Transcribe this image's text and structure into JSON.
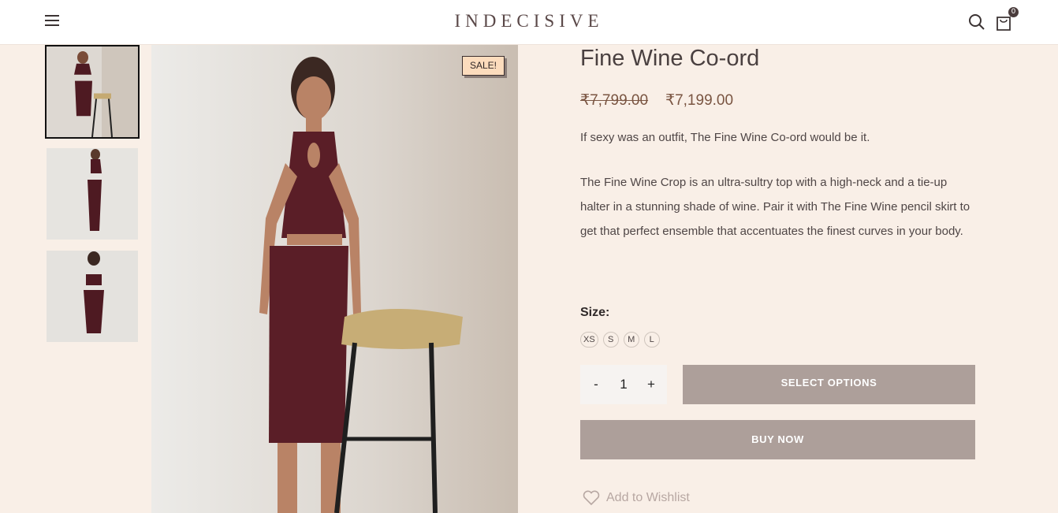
{
  "header": {
    "logo": "INDECISIVE",
    "cart_count": "0"
  },
  "gallery": {
    "sale_badge": "SALE!"
  },
  "product": {
    "title": "Fine Wine Co-ord",
    "price_old": "₹7,799.00",
    "price_new": "₹7,199.00",
    "tagline": "If sexy was an outfit, The Fine Wine Co-ord would be it.",
    "description": "The Fine Wine Crop is an ultra-sultry top with a high-neck and a tie-up halter in a stunning shade of wine. Pair it with The Fine Wine pencil skirt to get that perfect ensemble that accentuates the finest curves in your body.",
    "size_label": "Size:",
    "sizes": [
      "XS",
      "S",
      "M",
      "L"
    ],
    "quantity": "1",
    "qty_minus": "-",
    "qty_plus": "+",
    "select_options_label": "SELECT OPTIONS",
    "buy_now_label": "BUY NOW",
    "wishlist_label": "Add to Wishlist"
  },
  "colors": {
    "background": "#f9efe7",
    "button": "#ad9f9a",
    "price": "#7a5542",
    "badge": "#fcdcbd",
    "garment": "#5a1e27"
  }
}
